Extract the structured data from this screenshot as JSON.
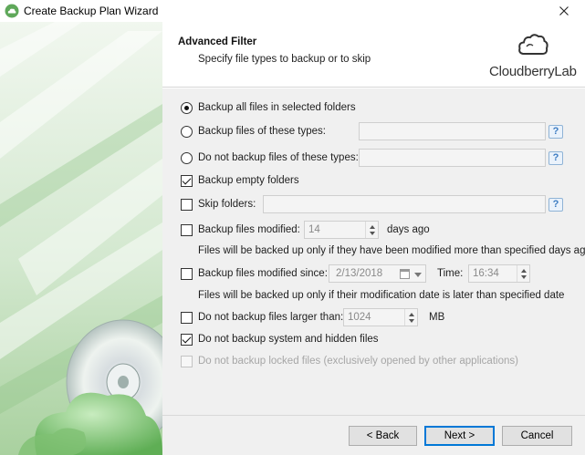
{
  "window": {
    "title": "Create Backup Plan Wizard",
    "close_glyph": "✕"
  },
  "header": {
    "title": "Advanced Filter",
    "subtitle": "Specify file types to backup or to skip",
    "logo_text": "CloudberryLab",
    "logo_icon": "cloud-icon"
  },
  "options": {
    "backup_all": {
      "label": "Backup all files in selected folders",
      "selected": true
    },
    "backup_types": {
      "label": "Backup files of these types:",
      "value": ""
    },
    "skip_types": {
      "label": "Do not backup files of these types:",
      "value": ""
    },
    "backup_empty": {
      "label": "Backup empty folders",
      "checked": true
    },
    "skip_folders": {
      "label": "Skip folders:",
      "value": ""
    },
    "modified": {
      "label": "Backup files modified:",
      "value": "14",
      "unit": "days ago",
      "note": "Files will be backed up only if they have been modified more than specified days ago"
    },
    "modified_since": {
      "label": "Backup files modified since:",
      "date": "2/13/2018",
      "time_label": "Time:",
      "time": "16:34",
      "note": "Files will be backed up only if their modification date is later than specified date"
    },
    "size_limit": {
      "label": "Do not backup files larger than:",
      "value": "1024",
      "unit": "MB"
    },
    "skip_system": {
      "label": "Do not backup system and hidden files",
      "checked": true
    },
    "skip_locked": {
      "label": "Do not backup locked files (exclusively opened by other applications)",
      "checked": false,
      "disabled": true
    }
  },
  "help_glyph": "?",
  "footer": {
    "back_label": "< Back",
    "next_label": "Next >",
    "cancel_label": "Cancel"
  },
  "colors": {
    "accent": "#0078d7",
    "side_panel": "#d9ead7",
    "content_bg": "#f0f0f0"
  }
}
